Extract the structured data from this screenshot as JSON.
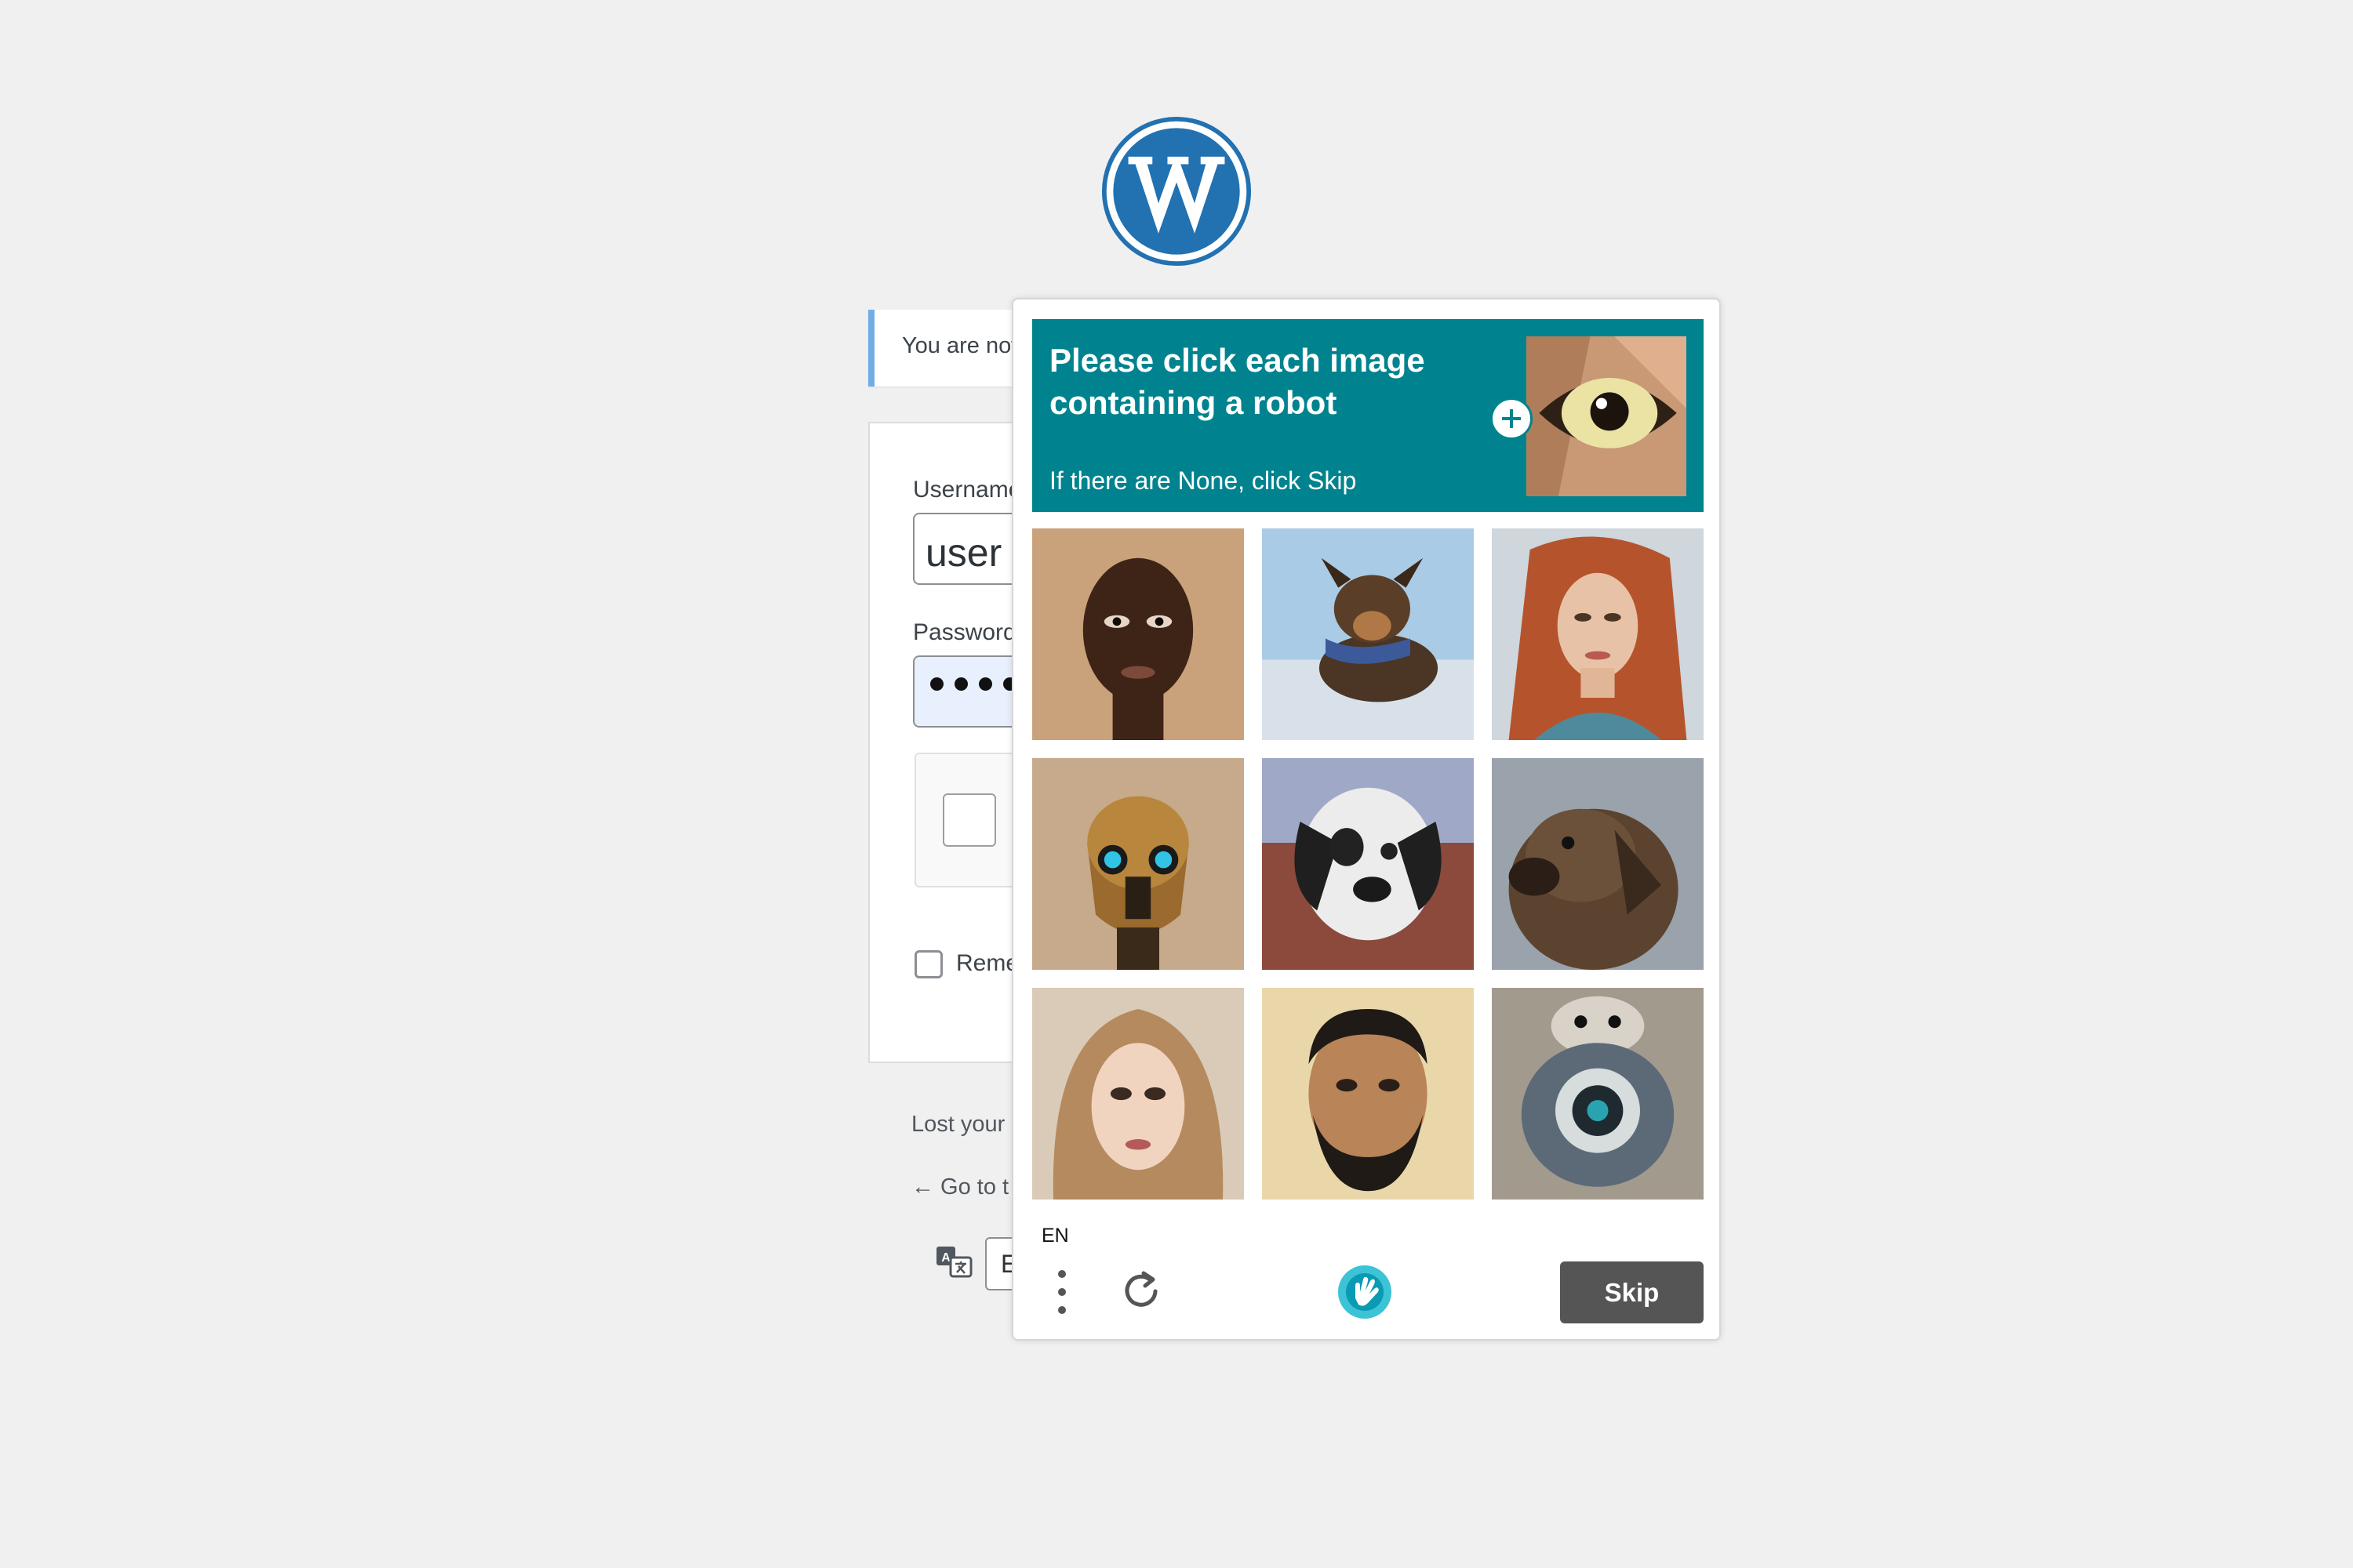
{
  "notice": {
    "text": "You are now"
  },
  "login": {
    "username_label": "Username",
    "username_value": "user",
    "password_label": "Password",
    "remember_label": "Remember Me"
  },
  "links": {
    "lost_password": "Lost your",
    "back_to_site": "← Go to t"
  },
  "language_select": {
    "value": "E"
  },
  "captcha": {
    "prompt_title": "Please click each image containing a robot",
    "prompt_subtitle": "If there are None, click Skip",
    "language_code": "EN",
    "skip_label": "Skip"
  },
  "colors": {
    "wordpress_blue": "#2271b1",
    "prompt_teal": "#00838f",
    "skip_grey": "#555555",
    "notice_border": "#72aee6"
  },
  "icons": {
    "logo": "wordpress-logo",
    "zoom": "plus-circle-icon",
    "menu": "vertical-ellipsis-icon",
    "refresh": "refresh-icon",
    "brand": "hcaptcha-hand-icon",
    "translate": "translate-icon"
  }
}
